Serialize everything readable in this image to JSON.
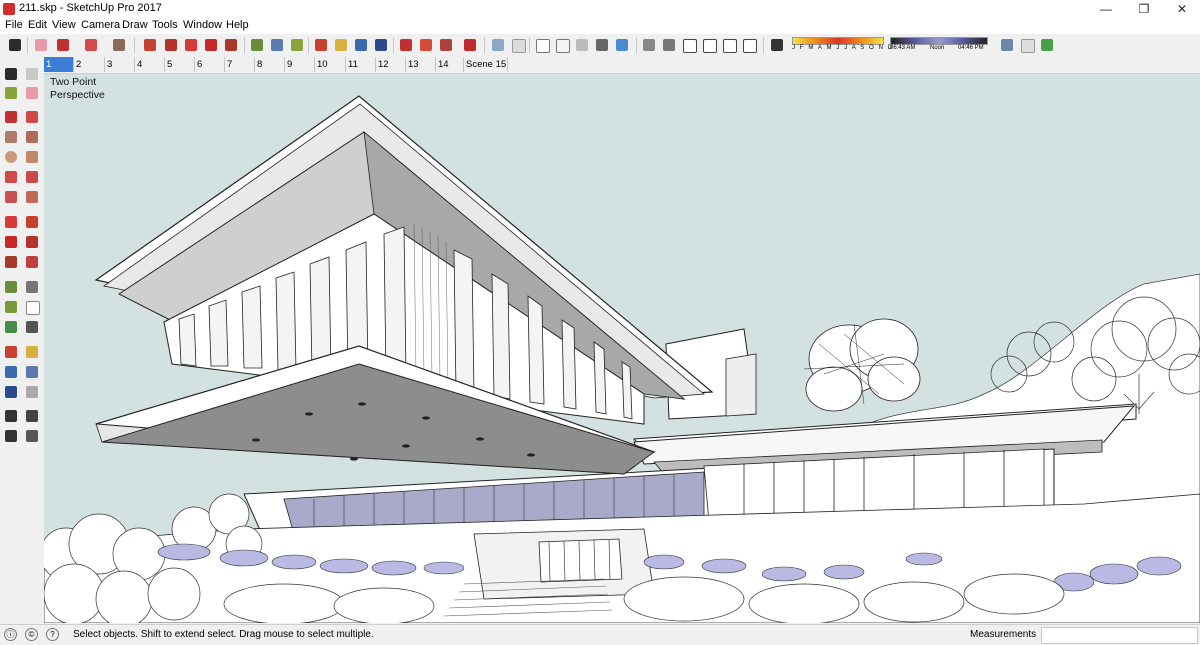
{
  "window": {
    "title": "211.skp - SketchUp Pro 2017"
  },
  "menu": [
    "File",
    "Edit",
    "View",
    "Camera",
    "Draw",
    "Tools",
    "Window",
    "Help"
  ],
  "shadow": {
    "months": "J F M A M J J A S O N D",
    "time_start": "06:43 AM",
    "time_mid": "Noon",
    "time_end": "04:46 PM"
  },
  "scenes": {
    "tabs": [
      "1",
      "2",
      "3",
      "4",
      "5",
      "6",
      "7",
      "8",
      "9",
      "10",
      "11",
      "12",
      "13",
      "14",
      "Scene 15"
    ],
    "active_index": 0
  },
  "viewport": {
    "camera_line1": "Two Point",
    "camera_line2": "Perspective"
  },
  "status": {
    "hint": "Select objects. Shift to extend select. Drag mouse to select multiple.",
    "measurements_label": "Measurements",
    "measurements_value": ""
  },
  "toolbar_icons": [
    "select-icon",
    "eraser-icon",
    "pencil-icon",
    "arc-icon",
    "paint-bucket-icon",
    "push-pull-icon",
    "follow-me-icon",
    "move-icon",
    "rotate-icon",
    "scale-icon",
    "tape-measure-icon",
    "text-icon",
    "paint-icon",
    "orbit-icon",
    "pan-icon",
    "zoom-icon",
    "zoom-extents-icon",
    "component-icon",
    "warehouse-icon",
    "extension-icon",
    "ruby-icon",
    "xray-icon",
    "back-edges-icon",
    "wireframe-icon",
    "hidden-line-icon",
    "shaded-icon",
    "shaded-texture-icon",
    "monochrome-icon",
    "iso-view-icon",
    "top-view-icon",
    "front-view-icon",
    "right-view-icon",
    "back-view-icon",
    "left-view-icon",
    "shadows-icon",
    "sync-icon",
    "fog-icon",
    "send-icon"
  ],
  "left_icons": [
    "select-tool-icon",
    "component-tool-icon",
    "paint-tool-icon",
    "eraser-tool-icon",
    "line-tool-icon",
    "freehand-tool-icon",
    "rectangle-tool-icon",
    "rotated-rect-icon",
    "circle-tool-icon",
    "polygon-tool-icon",
    "arc-tool-icon",
    "pie-tool-icon",
    "three-point-arc-icon",
    "two-point-arc-icon",
    "move-tool-icon",
    "push-pull-tool-icon",
    "rotate-tool-icon",
    "follow-me-tool-icon",
    "scale-tool-icon",
    "offset-tool-icon",
    "tape-tool-icon",
    "dimension-tool-icon",
    "protractor-icon",
    "text-tool-icon",
    "axes-tool-icon",
    "3d-text-icon",
    "orbit-tool-icon",
    "pan-tool-icon",
    "zoom-tool-icon",
    "zoom-window-icon",
    "zoom-extents-tool-icon",
    "previous-icon",
    "position-camera-icon",
    "look-around-icon",
    "walk-icon",
    "section-plane-icon"
  ],
  "colors": {
    "accent": "#3a7fd5",
    "sky": "#d4e1e1"
  }
}
